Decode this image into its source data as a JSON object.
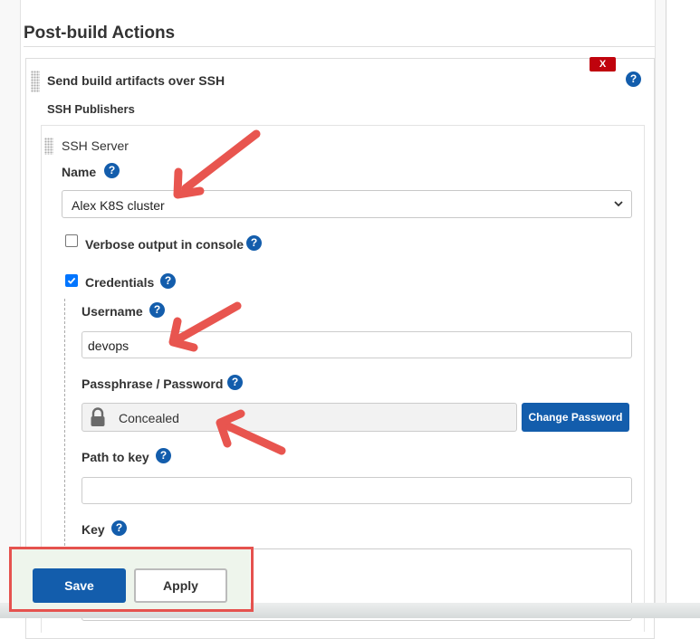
{
  "section": {
    "title": "Post-build Actions"
  },
  "plugin": {
    "title": "Send build artifacts over SSH",
    "delete_label": "X",
    "publishers_label": "SSH Publishers"
  },
  "server": {
    "heading": "SSH Server",
    "name_label": "Name",
    "name_value": "Alex K8S cluster",
    "verbose_label": "Verbose output in console",
    "verbose_checked": false,
    "credentials_label": "Credentials",
    "credentials_checked": true,
    "username_label": "Username",
    "username_value": "devops",
    "password_label": "Passphrase / Password",
    "password_value": "Concealed",
    "change_password_label": "Change Password",
    "path_label": "Path to key",
    "path_value": "",
    "key_label": "Key"
  },
  "help_glyph": "?",
  "footer": {
    "save_label": "Save",
    "apply_label": "Apply"
  },
  "annotation": {
    "arrow_color": "#e8554f"
  },
  "colors": {
    "primary": "#135dac",
    "danger": "#c0030d"
  }
}
